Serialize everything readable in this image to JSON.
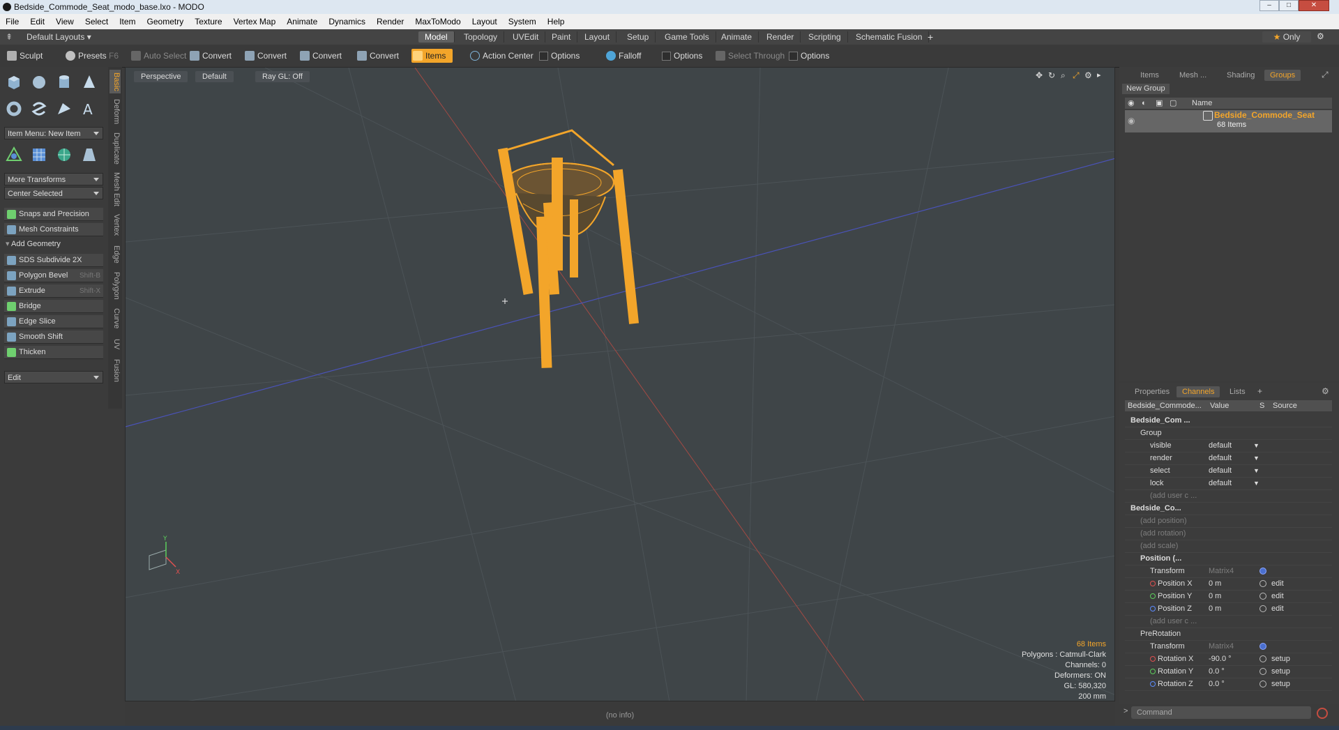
{
  "window": {
    "title": "Bedside_Commode_Seat_modo_base.lxo - MODO",
    "min": "–",
    "max": "□",
    "close": "✕"
  },
  "menu": [
    "File",
    "Edit",
    "View",
    "Select",
    "Item",
    "Geometry",
    "Texture",
    "Vertex Map",
    "Animate",
    "Dynamics",
    "Render",
    "MaxToModo",
    "Layout",
    "System",
    "Help"
  ],
  "layouts": {
    "preset": "Default Layouts",
    "tabs": [
      "Model",
      "Topology",
      "UVEdit",
      "Paint",
      "Layout",
      "Setup",
      "Game Tools",
      "Animate",
      "Render",
      "Scripting",
      "Schematic Fusion"
    ],
    "add": "+",
    "only": "Only"
  },
  "toolbar": {
    "sculpt": "Sculpt",
    "presets": "Presets",
    "presets_key": "F6",
    "auto_select": "Auto Select",
    "convert1": "Convert",
    "convert2": "Convert",
    "convert3": "Convert",
    "convert4": "Convert",
    "items": "Items",
    "action_center": "Action Center",
    "options1": "Options",
    "falloff": "Falloff",
    "options2": "Options",
    "select_through": "Select Through",
    "options3": "Options"
  },
  "left": {
    "item_menu": "Item Menu: New Item",
    "more_transforms": "More Transforms",
    "center_selected": "Center Selected",
    "snaps": "Snaps and Precision",
    "constraints": "Mesh Constraints",
    "add_geometry": "Add Geometry",
    "tools": [
      {
        "label": "SDS Subdivide 2X",
        "key": ""
      },
      {
        "label": "Polygon Bevel",
        "key": "Shift-B"
      },
      {
        "label": "Extrude",
        "key": "Shift-X"
      },
      {
        "label": "Bridge",
        "key": ""
      },
      {
        "label": "Edge Slice",
        "key": ""
      },
      {
        "label": "Smooth Shift",
        "key": ""
      },
      {
        "label": "Thicken",
        "key": ""
      }
    ],
    "edit": "Edit",
    "vtabs": [
      "Basic",
      "Deform",
      "Duplicate",
      "Mesh Edit",
      "Vertex",
      "Edge",
      "Polygon",
      "Curve",
      "UV",
      "Fusion"
    ]
  },
  "viewport": {
    "view": "Perspective",
    "shading": "Default",
    "raygl": "Ray GL: Off",
    "stats": {
      "items": "68 Items",
      "polygons": "Polygons : Catmull-Clark",
      "channels": "Channels: 0",
      "deformers": "Deformers: ON",
      "gl": "GL: 580,320",
      "size": "200 mm"
    },
    "axis_y": "Y",
    "axis_x": "X"
  },
  "status": {
    "info": "(no info)"
  },
  "groups_panel": {
    "tabs": [
      "Items",
      "Mesh ...",
      "Shading",
      "Groups"
    ],
    "new_group": "New Group",
    "col_name": "Name",
    "group_name": "Bedside_Commode_Seat",
    "group_count": "68 Items"
  },
  "channels_panel": {
    "tabs": [
      "Properties",
      "Channels",
      "Lists"
    ],
    "add": "+",
    "col_name": "Bedside_Commode...",
    "col_value": "Value",
    "col_s": "S",
    "col_source": "Source",
    "rows": [
      {
        "name": "Bedside_Com ...",
        "value": "",
        "source": "",
        "indent": 0,
        "style": "bold"
      },
      {
        "name": "Group",
        "value": "",
        "source": "",
        "indent": 1,
        "style": ""
      },
      {
        "name": "visible",
        "value": "default",
        "source": "",
        "indent": 2,
        "style": ""
      },
      {
        "name": "render",
        "value": "default",
        "source": "",
        "indent": 2,
        "style": ""
      },
      {
        "name": "select",
        "value": "default",
        "source": "",
        "indent": 2,
        "style": ""
      },
      {
        "name": "lock",
        "value": "default",
        "source": "",
        "indent": 2,
        "style": ""
      },
      {
        "name": "(add user c ...",
        "value": "",
        "source": "",
        "indent": 2,
        "style": "dim"
      },
      {
        "name": "Bedside_Co...",
        "value": "",
        "source": "",
        "indent": 0,
        "style": "bold"
      },
      {
        "name": "(add position)",
        "value": "",
        "source": "",
        "indent": 1,
        "style": "dim"
      },
      {
        "name": "(add rotation)",
        "value": "",
        "source": "",
        "indent": 1,
        "style": "dim"
      },
      {
        "name": "(add scale)",
        "value": "",
        "source": "",
        "indent": 1,
        "style": "dim"
      },
      {
        "name": "Position (...",
        "value": "",
        "source": "",
        "indent": 1,
        "style": "bold"
      },
      {
        "name": "Transform",
        "value": "Matrix4",
        "source": "",
        "indent": 2,
        "style": "",
        "vdim": true,
        "sfill": true
      },
      {
        "name": "Position X",
        "value": "0 m",
        "source": "edit",
        "indent": 2,
        "style": "",
        "dot": "r"
      },
      {
        "name": "Position Y",
        "value": "0 m",
        "source": "edit",
        "indent": 2,
        "style": "",
        "dot": "g"
      },
      {
        "name": "Position Z",
        "value": "0 m",
        "source": "edit",
        "indent": 2,
        "style": "",
        "dot": "b"
      },
      {
        "name": "(add user c ...",
        "value": "",
        "source": "",
        "indent": 2,
        "style": "dim"
      },
      {
        "name": "PreRotation",
        "value": "",
        "source": "",
        "indent": 1,
        "style": ""
      },
      {
        "name": "Transform",
        "value": "Matrix4",
        "source": "",
        "indent": 2,
        "style": "",
        "vdim": true,
        "sfill": true
      },
      {
        "name": "Rotation X",
        "value": "-90.0 °",
        "source": "setup",
        "indent": 2,
        "style": "",
        "dot": "r"
      },
      {
        "name": "Rotation Y",
        "value": "0.0 °",
        "source": "setup",
        "indent": 2,
        "style": "",
        "dot": "g"
      },
      {
        "name": "Rotation Z",
        "value": "0.0 °",
        "source": "setup",
        "indent": 2,
        "style": "",
        "dot": "b"
      }
    ]
  },
  "command": {
    "placeholder": "Command",
    "prompt": ">"
  },
  "colors": {
    "accent": "#f3a52a",
    "viewport": "#3f4548",
    "mesh": "#f3a52a"
  }
}
